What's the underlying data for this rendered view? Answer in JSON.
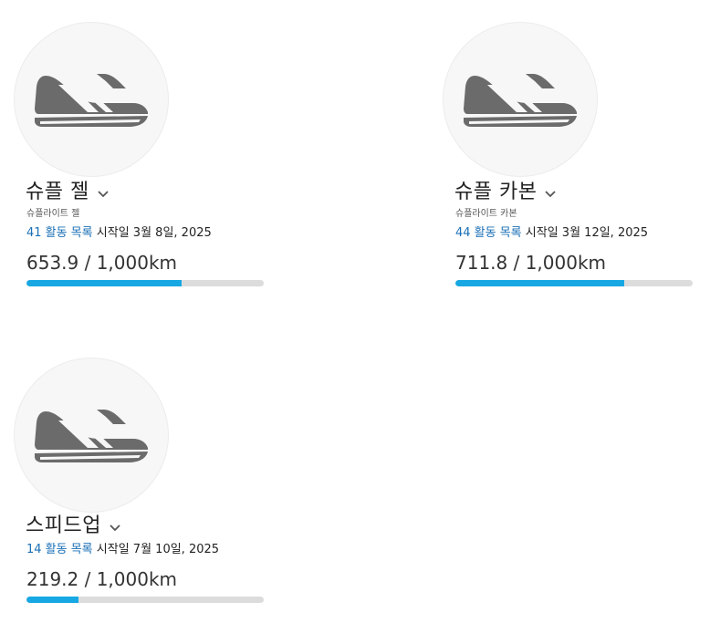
{
  "gear": [
    {
      "name": "슈플 젤",
      "model": "슈플라이트 젤",
      "activity_link": "41 활동 목록",
      "start_date": "시작일 3월 8일, 2025",
      "distance_text": "653.9 / 1,000km",
      "distance_value": 653.9,
      "distance_max": 1000,
      "icon": "running-shoe-icon"
    },
    {
      "name": "슈플 카본",
      "model": "슈플라이트 카본",
      "activity_link": "44 활동 목록",
      "start_date": "시작일 3월 12일, 2025",
      "distance_text": "711.8 / 1,000km",
      "distance_value": 711.8,
      "distance_max": 1000,
      "icon": "running-shoe-icon"
    },
    {
      "name": "스피드업",
      "activity_link": "14 활동 목록",
      "start_date": "시작일 7월 10일, 2025",
      "distance_text": "219.2 / 1,000km",
      "distance_value": 219.2,
      "distance_max": 1000,
      "icon": "running-shoe-icon"
    }
  ],
  "colors": {
    "link": "#1a6fb5",
    "progress_fill": "#17a8e3",
    "progress_track": "#dcdcdc",
    "icon": "#6b6b6b"
  }
}
